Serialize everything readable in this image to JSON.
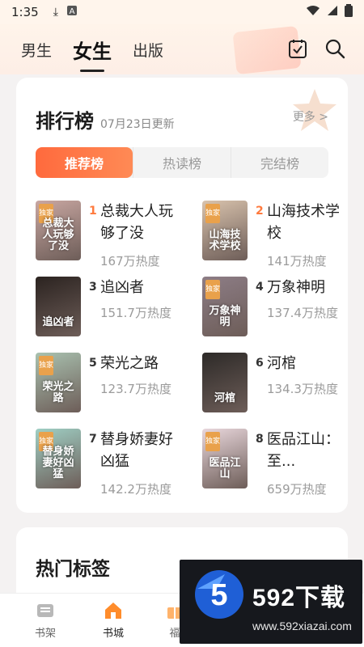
{
  "status_bar": {
    "time": "1:35"
  },
  "top_nav": {
    "tabs": [
      "男生",
      "女生",
      "出版"
    ]
  },
  "ranking": {
    "title": "排行榜",
    "date": "07月23日更新",
    "more": "更多 >",
    "segments": [
      "推荐榜",
      "热读榜",
      "完结榜"
    ],
    "books": [
      {
        "rank": "1",
        "title": "总裁大人玩够了没",
        "heat": "167万热度",
        "cover_title": "总裁大人玩够了没",
        "cover_color": "#c9a7a2",
        "badge": "独家"
      },
      {
        "rank": "2",
        "title": "山海技术学校",
        "heat": "141万热度",
        "cover_title": "山海技术学校",
        "cover_color": "#d9c3ad",
        "badge": "独家"
      },
      {
        "rank": "3",
        "title": "追凶者",
        "heat": "151.7万热度",
        "cover_title": "追凶者",
        "cover_color": "#2b2320",
        "badge": ""
      },
      {
        "rank": "4",
        "title": "万象神明",
        "heat": "137.4万热度",
        "cover_title": "万象神明",
        "cover_color": "#8d7d86",
        "badge": "独家"
      },
      {
        "rank": "5",
        "title": "荣光之路",
        "heat": "123.7万热度",
        "cover_title": "荣光之路",
        "cover_color": "#a9c2b0",
        "badge": "独家"
      },
      {
        "rank": "6",
        "title": "河棺",
        "heat": "134.3万热度",
        "cover_title": "河棺",
        "cover_color": "#2d2a28",
        "badge": ""
      },
      {
        "rank": "7",
        "title": "替身娇妻好凶猛",
        "heat": "142.2万热度",
        "cover_title": "替身娇妻好凶猛",
        "cover_color": "#9fcfc4",
        "badge": "独家"
      },
      {
        "rank": "8",
        "title": "医品江山：至...",
        "heat": "659万热度",
        "cover_title": "医品江山",
        "cover_color": "#e9d7dc",
        "badge": "独家"
      }
    ]
  },
  "tags": {
    "title": "热门标签"
  },
  "bottom_nav": {
    "items": [
      "书架",
      "书城",
      "福"
    ]
  },
  "watermark": {
    "brand": "592下载",
    "url": "www.592xiazai.com"
  },
  "colors": {
    "accent": "#ff6a3d",
    "top_rank": "#ff7a3d",
    "active_nav": "#ff8c2b"
  }
}
